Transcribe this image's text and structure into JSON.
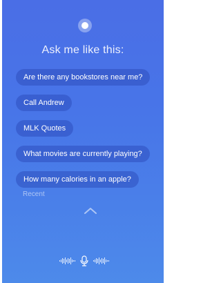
{
  "header": {
    "title": "Ask me like this:"
  },
  "suggestions": [
    "Are there any bookstores near me?",
    "Call Andrew",
    "MLK Quotes",
    "What movies are currently playing?",
    "How many calories in an apple?"
  ],
  "recent": {
    "label": "Recent"
  },
  "colors": {
    "background_top": "#4a6ee6",
    "background_bottom": "#4d8aea",
    "chip": "#2e4ebe"
  },
  "icons": {
    "orb": "assistant-orb-icon",
    "expand": "chevron-up-icon",
    "mic": "microphone-icon",
    "wave": "waveform-icon"
  }
}
